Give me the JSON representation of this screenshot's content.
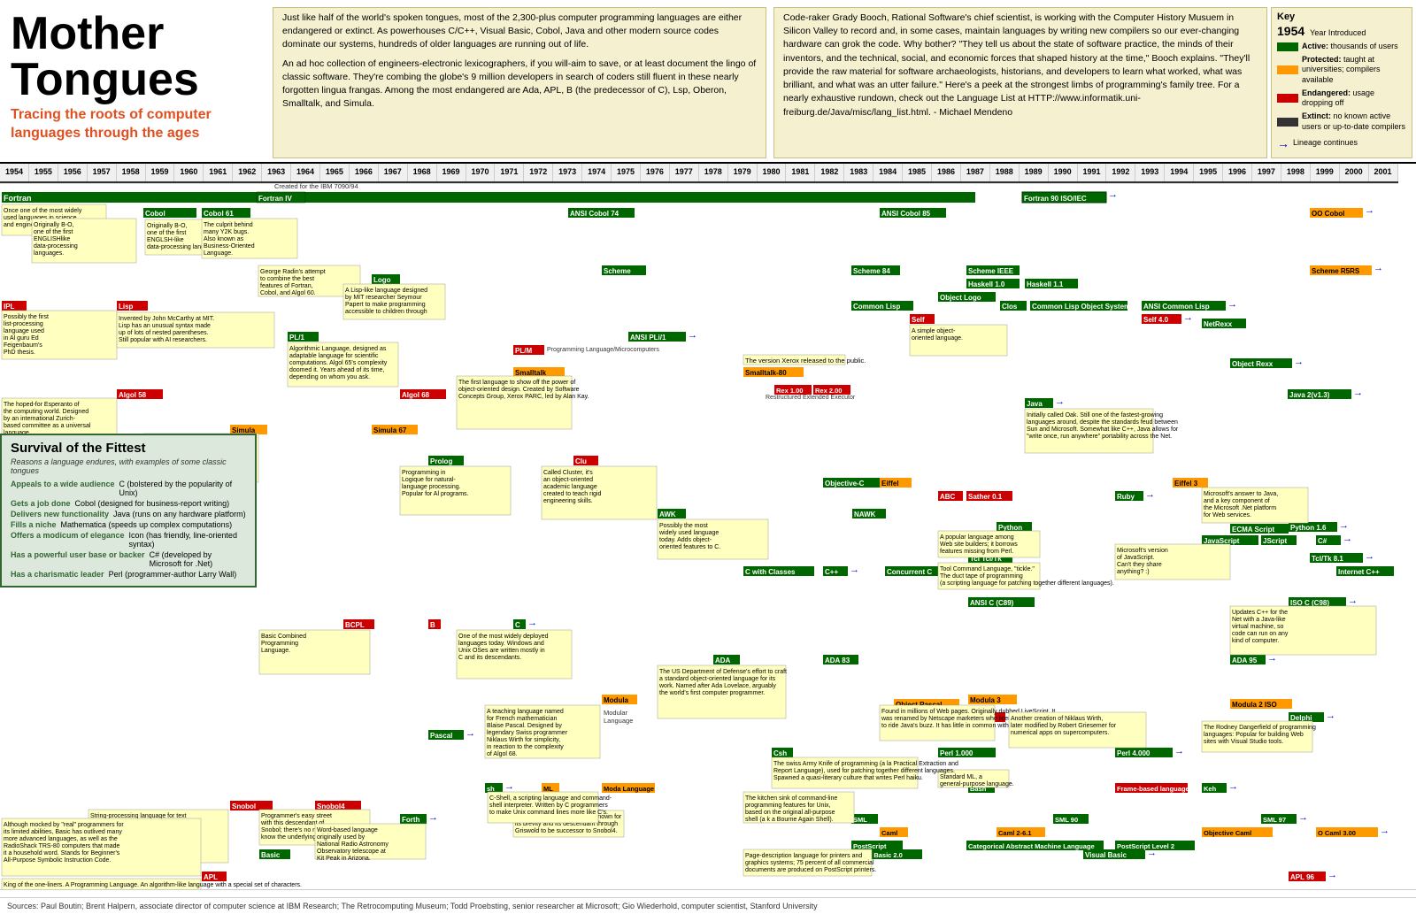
{
  "title": {
    "main": "Mother Tongues",
    "subtitle": "Tracing the roots of computer languages through the ages"
  },
  "intro": {
    "left_paragraph1": "Just like half of the world's spoken tongues, most of the 2,300-plus computer programming languages are either endangered or extinct. As powerhouses C/C++, Visual Basic, Cobol, Java and other modern source codes dominate our systems, hundreds of older languages are running out of life.",
    "left_paragraph2": "An ad hoc collection of engineers-electronic lexicographers, if you will-aim to save, or at least document the lingo of classic software. They're combing the globe's 9 million developers in search of coders still fluent in these nearly forgotten lingua frangas. Among the most endangered are Ada, APL, B (the predecessor of C), Lsp, Oberon, Smalltalk, and Simula.",
    "right_paragraph1": "Code-raker Grady Booch, Rational Software's chief scientist, is working with the Computer History Musuem in Silicon Valley to record and, in some cases, maintain languages by writing new compilers so our ever-changing hardware can grok the code. Why bother? \"They tell us about the state of software practice, the minds of their inventors, and the technical, social, and economic forces that shaped history at the time,\" Booch explains. \"They'll provide the raw material for software archaeologists, historians, and developers to learn what worked, what was brilliant, and what was an utter failure.\" Here's a peek at the strongest limbs of programming's family tree. For a nearly exhaustive rundown, check out the Language List at HTTP://www.informatik.uni-freiburg.de/Java/misc/lang_list.html. - Michael Mendeno"
  },
  "key": {
    "title": "Key",
    "year_label": "1954",
    "year_desc": "Year Introduced",
    "active_label": "Active:",
    "active_desc": "thousands of users",
    "protected_label": "Protected:",
    "protected_desc": "taught at universities; compilers available",
    "endangered_label": "Endangered:",
    "endangered_desc": "usage dropping off",
    "extinct_label": "Extinct:",
    "extinct_desc": "no known active users or up-to-date compilers",
    "lineage_label": "Lineage continues"
  },
  "survival": {
    "title": "Survival of the Fittest",
    "subtitle": "Reasons a language endures, with examples of some classic tongues",
    "rows": [
      {
        "label": "Appeals to a wide audience",
        "text": "C (bolstered by the popularity of Unix)"
      },
      {
        "label": "Gets a job done",
        "text": "Cobol (designed for business-report writing)"
      },
      {
        "label": "Delivers new functionality",
        "text": "Java (runs on any hardware platform)"
      },
      {
        "label": "Fills a niche",
        "text": "Mathematica (speeds up complex computations)"
      },
      {
        "label": "Offers a modicum of elegance",
        "text": "Icon (has friendly, line-oriented syntax)"
      },
      {
        "label": "Has a powerful user base or backer",
        "text": "C# (developed by Microsoft for .Net)"
      },
      {
        "label": "Has a charismatic leader",
        "text": "Perl (programmer-author Larry Wall)"
      }
    ]
  },
  "footer": "Sources: Paul Boutin; Brent Halpern, associate director of computer science at IBM Research; The Retrocomputing Museum; Todd Proebsting, senior researcher at Microsoft; Gio Wiederhold, computer scientist, Stanford University",
  "years": [
    "1954",
    "1955",
    "1956",
    "1957",
    "1958",
    "1959",
    "1960",
    "1961",
    "1962",
    "1963",
    "1964",
    "1965",
    "1966",
    "1967",
    "1968",
    "1969",
    "1970",
    "1971",
    "1972",
    "1973",
    "1974",
    "1975",
    "1976",
    "1977",
    "1978",
    "1979",
    "1980",
    "1981",
    "1982",
    "1983",
    "1984",
    "1985",
    "1986",
    "1987",
    "1988",
    "1989",
    "1990",
    "1991",
    "1992",
    "1993",
    "1994",
    "1995",
    "1996",
    "1997",
    "1998",
    "1999",
    "2000",
    "2001"
  ]
}
